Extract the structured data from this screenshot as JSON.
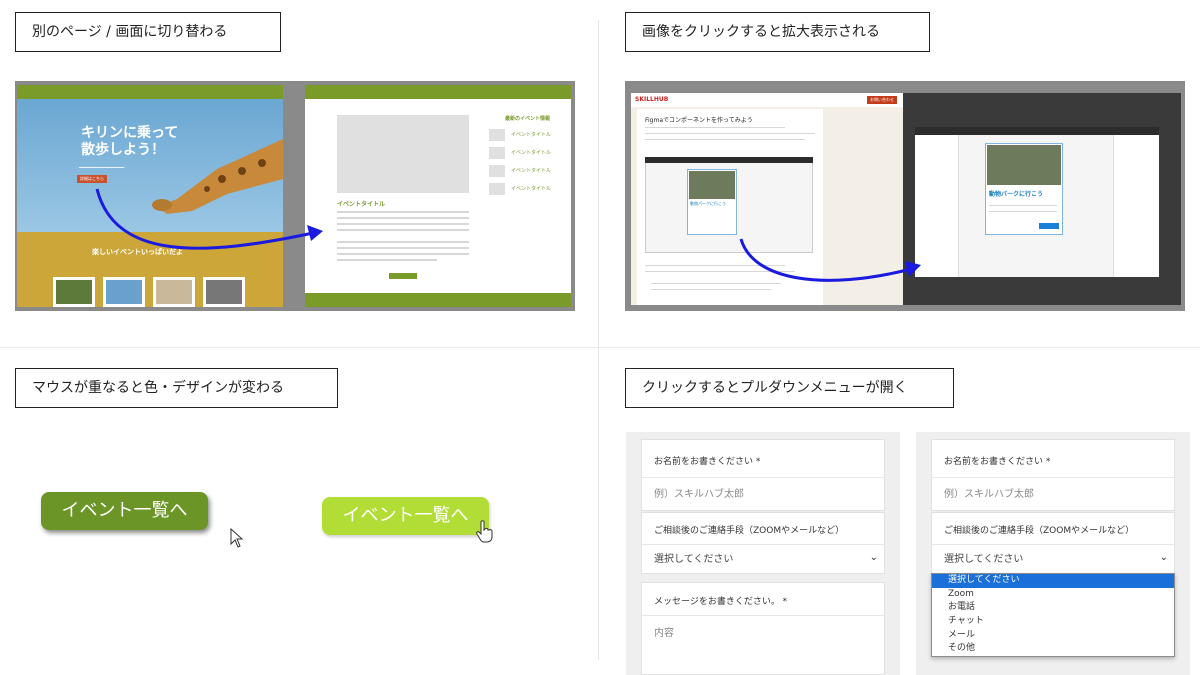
{
  "sections": {
    "page_change": {
      "label": "別のページ / 画面に切り替わる"
    },
    "image_zoom": {
      "label": "画像をクリックすると拡大表示される"
    },
    "hover": {
      "label": "マウスが重なると色・デザインが変わる"
    },
    "dropdown": {
      "label": "クリックするとプルダウンメニューが開く"
    }
  },
  "page_change_demo": {
    "hero_title": "キリンに乗って\n散歩しよう！",
    "hero_button": "詳細はこちら",
    "events_heading": "楽しいイベントいっぱいだよ",
    "detail_event_title": "イベントタイトル",
    "sidebar_heading": "最新のイベント情報",
    "sidebar_item": "イベントタイトル"
  },
  "zoom_demo": {
    "logo": "SKILLHUB",
    "header_button": "お問い合わせ",
    "article_title": "Figmaでコンポーネントを作ってみよう",
    "card_title": "動物パークに行こう",
    "card_title_large": "動物パークに行こう"
  },
  "hover_demo": {
    "button_label": "イベント一覧へ",
    "button_label_hover": "イベント一覧へ"
  },
  "form_left": {
    "name_label": "お名前をお書きください *",
    "name_placeholder": "例）スキルハブ太郎",
    "contact_label": "ご相談後のご連絡手段（ZOOMやメールなど）",
    "contact_value": "選択してください",
    "message_label": "メッセージをお書きください。 *",
    "message_placeholder": "内容"
  },
  "form_right": {
    "name_label": "お名前をお書きください *",
    "name_placeholder": "例）スキルハブ太郎",
    "contact_label": "ご相談後のご連絡手段（ZOOMやメールなど）",
    "contact_value": "選択してください",
    "options": [
      "選択してください",
      "Zoom",
      "お電話",
      "チャット",
      "メール",
      "その他"
    ]
  },
  "colors": {
    "accent_green": "#7a9a2a",
    "hover_green": "#b1dd36",
    "arrow_blue": "#1a1ae0",
    "select_blue": "#1a6fd8"
  }
}
